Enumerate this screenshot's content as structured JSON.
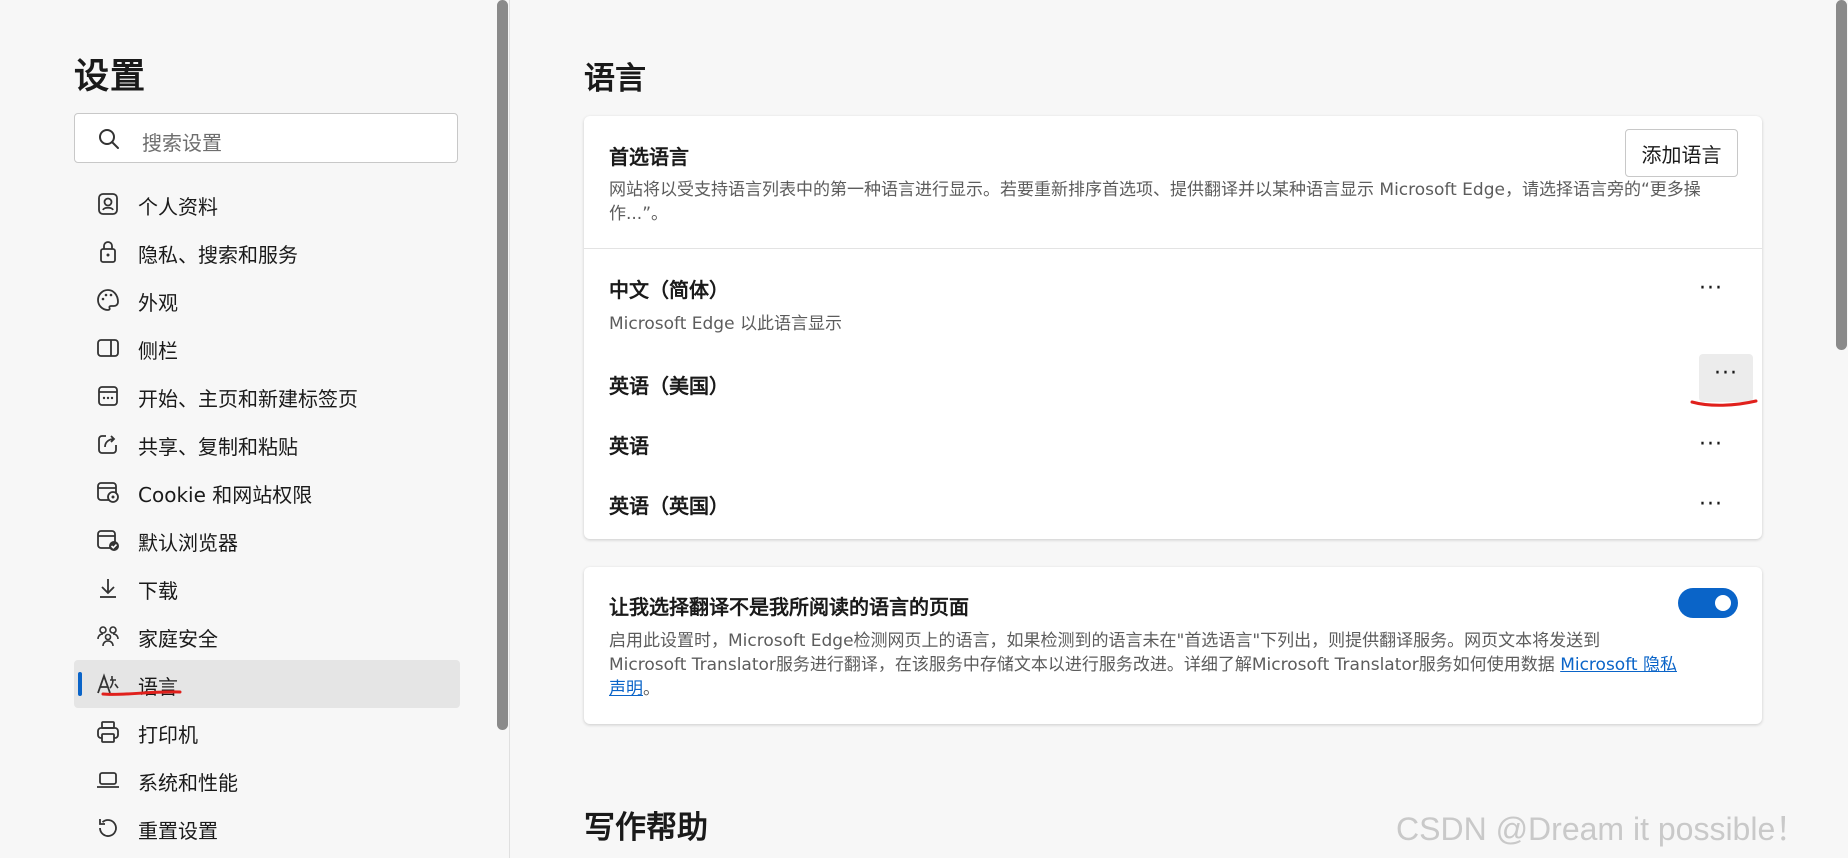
{
  "sidebar": {
    "title": "设置",
    "search_placeholder": "搜索设置",
    "items": [
      {
        "label": "个人资料",
        "icon": "profile-icon"
      },
      {
        "label": "隐私、搜索和服务",
        "icon": "lock-icon"
      },
      {
        "label": "外观",
        "icon": "palette-icon"
      },
      {
        "label": "侧栏",
        "icon": "sidebar-icon"
      },
      {
        "label": "开始、主页和新建标签页",
        "icon": "home-tabs-icon"
      },
      {
        "label": "共享、复制和粘贴",
        "icon": "share-icon"
      },
      {
        "label": "Cookie 和网站权限",
        "icon": "cookie-icon"
      },
      {
        "label": "默认浏览器",
        "icon": "browser-icon"
      },
      {
        "label": "下载",
        "icon": "download-icon"
      },
      {
        "label": "家庭安全",
        "icon": "family-icon"
      },
      {
        "label": "语言",
        "icon": "language-icon",
        "active": true
      },
      {
        "label": "打印机",
        "icon": "printer-icon"
      },
      {
        "label": "系统和性能",
        "icon": "laptop-icon"
      },
      {
        "label": "重置设置",
        "icon": "reset-icon"
      }
    ]
  },
  "main": {
    "title": "语言",
    "preferred": {
      "title": "首选语言",
      "add_button": "添加语言",
      "description": "网站将以受支持语言列表中的第一种语言进行显示。若要重新排序首选项、提供翻译并以某种语言显示 Microsoft Edge，请选择语言旁的“更多操作...”。",
      "languages": [
        {
          "name": "中文（简体）",
          "note": "Microsoft Edge 以此语言显示"
        },
        {
          "name": "英语（美国）"
        },
        {
          "name": "英语"
        },
        {
          "name": "英语（英国）"
        }
      ],
      "more_label": "···"
    },
    "translate": {
      "title": "让我选择翻译不是我所阅读的语言的页面",
      "enabled": true,
      "description_line1": "启用此设置时，Microsoft Edge检测网页上的语言，如果检测到的语言未在\"首选语言\"下列出，则提供翻译服务。网页文本将发送到",
      "description_line2": "Microsoft Translator服务进行翻译，在该服务中存储文本以进行服务改进。详细了解Microsoft Translator服务如何使用数据",
      "link1": "Microsoft 隐私",
      "link2": "声明",
      "end": "。"
    },
    "writing_title": "写作帮助"
  },
  "watermark": "CSDN @Dream it possible！",
  "colors": {
    "accent": "#0a64c8",
    "annotation": "#e0201c"
  }
}
